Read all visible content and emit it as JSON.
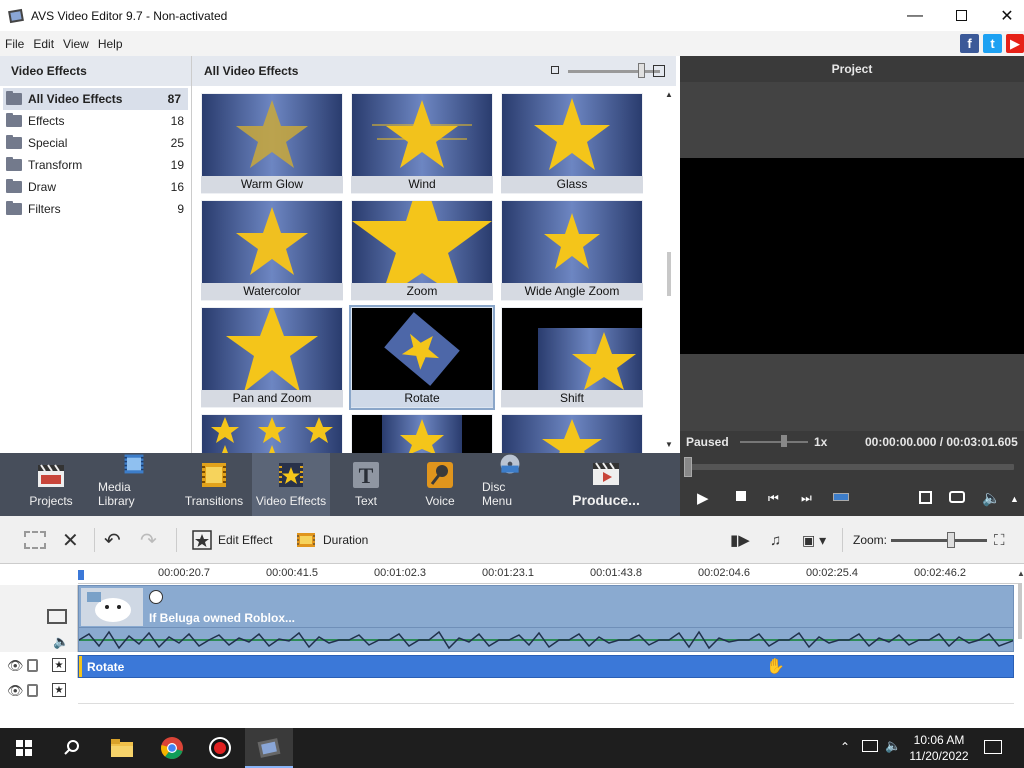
{
  "window": {
    "title": "AVS Video Editor 9.7 - Non-activated"
  },
  "menu": [
    "File",
    "Edit",
    "View",
    "Help"
  ],
  "left_panel": {
    "title": "Video Effects",
    "categories": [
      {
        "label": "All Video Effects",
        "count": "87"
      },
      {
        "label": "Effects",
        "count": "18"
      },
      {
        "label": "Special",
        "count": "25"
      },
      {
        "label": "Transform",
        "count": "19"
      },
      {
        "label": "Draw",
        "count": "16"
      },
      {
        "label": "Filters",
        "count": "9"
      }
    ]
  },
  "effects_panel": {
    "title": "All Video Effects",
    "tiles": [
      {
        "label": "Warm Glow"
      },
      {
        "label": "Wind"
      },
      {
        "label": "Glass"
      },
      {
        "label": "Watercolor"
      },
      {
        "label": "Zoom"
      },
      {
        "label": "Wide Angle Zoom"
      },
      {
        "label": "Pan and Zoom"
      },
      {
        "label": "Rotate"
      },
      {
        "label": "Shift"
      }
    ]
  },
  "preview": {
    "title": "Project",
    "status": "Paused",
    "speed": "1x",
    "time": "00:00:00.000 / 00:03:01.605"
  },
  "toolbar": {
    "items": [
      "Projects",
      "Media Library",
      "Transitions",
      "Video Effects",
      "Text",
      "Voice",
      "Disc Menu",
      "Produce..."
    ]
  },
  "edit_toolbar": {
    "edit_effect": "Edit Effect",
    "duration": "Duration",
    "zoom_label": "Zoom:"
  },
  "timeline": {
    "ticks": [
      "00:00:20.7",
      "00:00:41.5",
      "00:01:02.3",
      "00:01:23.1",
      "00:01:43.8",
      "00:02:04.6",
      "00:02:25.4",
      "00:02:46.2"
    ],
    "clip_title": "If Beluga owned Roblox...",
    "effect_label": "Rotate"
  },
  "taskbar": {
    "time": "10:06 AM",
    "date": "11/20/2022"
  },
  "colors": {
    "accent": "#3b78d8",
    "toolbar_bg": "#474e5b",
    "preview_bg": "#000000"
  }
}
